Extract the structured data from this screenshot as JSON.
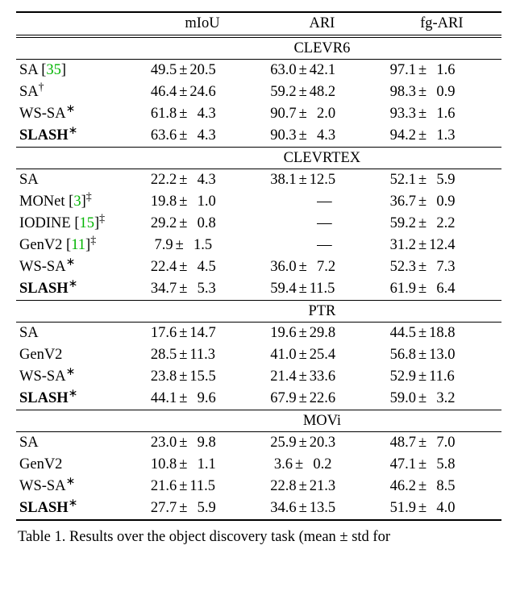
{
  "chart_data": {
    "type": "table",
    "title": "Results over the object discovery task (mean ± std)",
    "metrics": [
      "mIoU",
      "ARI",
      "fg-ARI"
    ],
    "sections": [
      {
        "name": "CLEVR6",
        "rows": [
          {
            "method": "SA",
            "cite": "35",
            "marks": "",
            "bold": false,
            "miou": {
              "m": "49.5",
              "s": "20.5",
              "sp": 0
            },
            "ari": {
              "m": "63.0",
              "s": "42.1",
              "sp": 0
            },
            "fg": {
              "m": "97.1",
              "s": "1.6",
              "sp": 2
            }
          },
          {
            "method": "SA",
            "cite": "",
            "marks": "†",
            "bold": false,
            "miou": {
              "m": "46.4",
              "s": "24.6",
              "sp": 0
            },
            "ari": {
              "m": "59.2",
              "s": "48.2",
              "sp": 0
            },
            "fg": {
              "m": "98.3",
              "s": "0.9",
              "sp": 2
            }
          },
          {
            "method": "WS-SA",
            "cite": "",
            "marks": "∗",
            "bold": false,
            "miou": {
              "m": "61.8",
              "s": "4.3",
              "sp": 2
            },
            "ari": {
              "m": "90.7",
              "s": "2.0",
              "sp": 2
            },
            "fg": {
              "m": "93.3",
              "s": "1.6",
              "sp": 2
            }
          },
          {
            "method": "SLASH",
            "cite": "",
            "marks": "∗",
            "bold": true,
            "miou": {
              "m": "63.6",
              "s": "4.3",
              "sp": 2
            },
            "ari": {
              "m": "90.3",
              "s": "4.3",
              "sp": 2
            },
            "fg": {
              "m": "94.2",
              "s": "1.3",
              "sp": 2
            }
          }
        ]
      },
      {
        "name": "CLEVRTEX",
        "rows": [
          {
            "method": "SA",
            "cite": "",
            "marks": "",
            "bold": false,
            "miou": {
              "m": "22.2",
              "s": "4.3",
              "sp": 2
            },
            "ari": {
              "m": "38.1",
              "s": "12.5",
              "sp": 0
            },
            "fg": {
              "m": "52.1",
              "s": "5.9",
              "sp": 2
            }
          },
          {
            "method": "MONet",
            "cite": "3",
            "marks": "‡",
            "bold": false,
            "miou": {
              "m": "19.8",
              "s": "1.0",
              "sp": 2
            },
            "ari": null,
            "fg": {
              "m": "36.7",
              "s": "0.9",
              "sp": 2
            }
          },
          {
            "method": "IODINE",
            "cite": "15",
            "marks": "‡",
            "bold": false,
            "miou": {
              "m": "29.2",
              "s": "0.8",
              "sp": 2
            },
            "ari": null,
            "fg": {
              "m": "59.2",
              "s": "2.2",
              "sp": 2
            }
          },
          {
            "method": "GenV2",
            "cite": "11",
            "marks": "‡",
            "bold": false,
            "miou": {
              "m": "7.9",
              "s": "1.5",
              "sp": 2,
              "lp": 1
            },
            "ari": null,
            "fg": {
              "m": "31.2",
              "s": "12.4",
              "sp": 0
            }
          },
          {
            "method": "WS-SA",
            "cite": "",
            "marks": "∗",
            "bold": false,
            "miou": {
              "m": "22.4",
              "s": "4.5",
              "sp": 2
            },
            "ari": {
              "m": "36.0",
              "s": "7.2",
              "sp": 2
            },
            "fg": {
              "m": "52.3",
              "s": "7.3",
              "sp": 2
            }
          },
          {
            "method": "SLASH",
            "cite": "",
            "marks": "∗",
            "bold": true,
            "miou": {
              "m": "34.7",
              "s": "5.3",
              "sp": 2
            },
            "ari": {
              "m": "59.4",
              "s": "11.5",
              "sp": 0
            },
            "fg": {
              "m": "61.9",
              "s": "6.4",
              "sp": 2
            }
          }
        ]
      },
      {
        "name": "PTR",
        "rows": [
          {
            "method": "SA",
            "cite": "",
            "marks": "",
            "bold": false,
            "miou": {
              "m": "17.6",
              "s": "14.7",
              "sp": 0
            },
            "ari": {
              "m": "19.6",
              "s": "29.8",
              "sp": 0
            },
            "fg": {
              "m": "44.5",
              "s": "18.8",
              "sp": 0
            }
          },
          {
            "method": "GenV2",
            "cite": "",
            "marks": "",
            "bold": false,
            "miou": {
              "m": "28.5",
              "s": "11.3",
              "sp": 0
            },
            "ari": {
              "m": "41.0",
              "s": "25.4",
              "sp": 0
            },
            "fg": {
              "m": "56.8",
              "s": "13.0",
              "sp": 0
            }
          },
          {
            "method": "WS-SA",
            "cite": "",
            "marks": "∗",
            "bold": false,
            "miou": {
              "m": "23.8",
              "s": "15.5",
              "sp": 0
            },
            "ari": {
              "m": "21.4",
              "s": "33.6",
              "sp": 0
            },
            "fg": {
              "m": "52.9",
              "s": "11.6",
              "sp": 0
            }
          },
          {
            "method": "SLASH",
            "cite": "",
            "marks": "∗",
            "bold": true,
            "miou": {
              "m": "44.1",
              "s": "9.6",
              "sp": 2
            },
            "ari": {
              "m": "67.9",
              "s": "22.6",
              "sp": 0
            },
            "fg": {
              "m": "59.0",
              "s": "3.2",
              "sp": 2
            }
          }
        ]
      },
      {
        "name": "MOVi",
        "rows": [
          {
            "method": "SA",
            "cite": "",
            "marks": "",
            "bold": false,
            "miou": {
              "m": "23.0",
              "s": "9.8",
              "sp": 2
            },
            "ari": {
              "m": "25.9",
              "s": "20.3",
              "sp": 0
            },
            "fg": {
              "m": "48.7",
              "s": "7.0",
              "sp": 2
            }
          },
          {
            "method": "GenV2",
            "cite": "",
            "marks": "",
            "bold": false,
            "miou": {
              "m": "10.8",
              "s": "1.1",
              "sp": 2
            },
            "ari": {
              "m": "3.6",
              "s": "0.2",
              "sp": 2,
              "lp": 1
            },
            "fg": {
              "m": "47.1",
              "s": "5.8",
              "sp": 2
            }
          },
          {
            "method": "WS-SA",
            "cite": "",
            "marks": "∗",
            "bold": false,
            "miou": {
              "m": "21.6",
              "s": "11.5",
              "sp": 0
            },
            "ari": {
              "m": "22.8",
              "s": "21.3",
              "sp": 0
            },
            "fg": {
              "m": "46.2",
              "s": "8.5",
              "sp": 2
            }
          },
          {
            "method": "SLASH",
            "cite": "",
            "marks": "∗",
            "bold": true,
            "miou": {
              "m": "27.7",
              "s": "5.9",
              "sp": 2
            },
            "ari": {
              "m": "34.6",
              "s": "13.5",
              "sp": 0
            },
            "fg": {
              "m": "51.9",
              "s": "4.0",
              "sp": 2
            }
          }
        ]
      }
    ]
  },
  "header": {
    "c1": "mIoU",
    "c2": "ARI",
    "c3": "fg-ARI"
  },
  "caption_prefix": "Table 1.",
  "caption_text": "Results over the object discovery task (mean ± std for"
}
